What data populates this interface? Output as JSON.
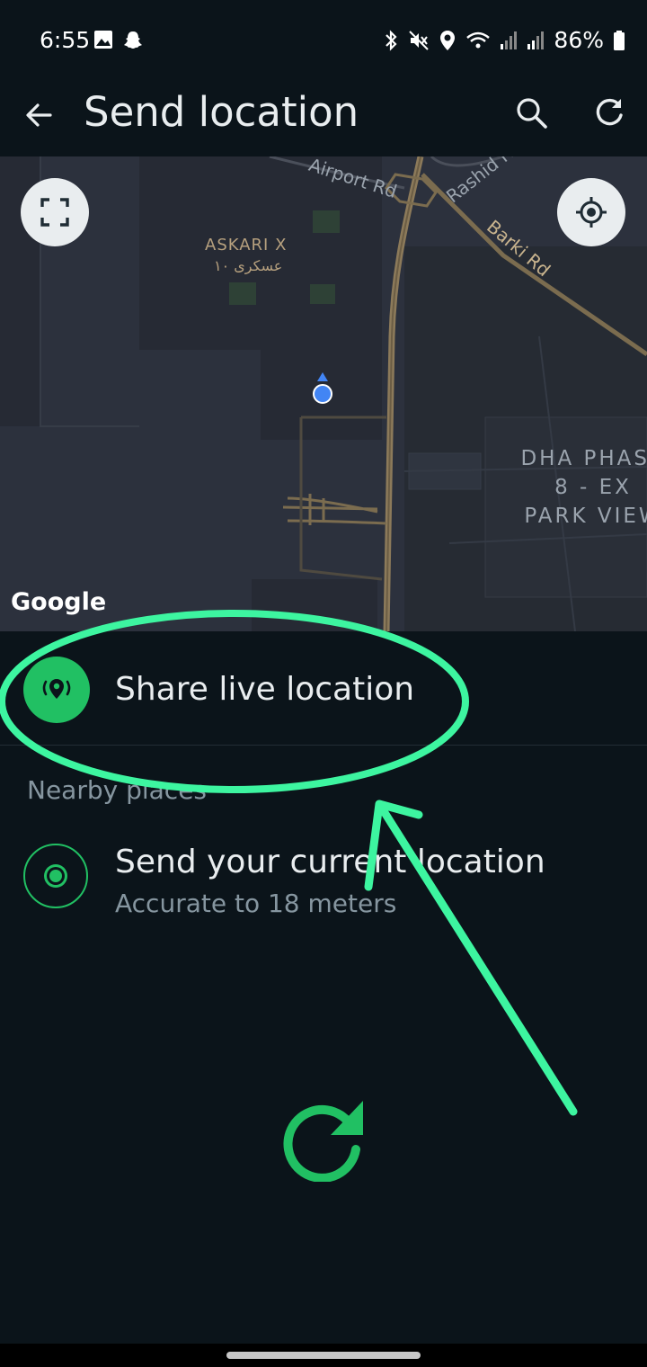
{
  "status_bar": {
    "time": "6:55",
    "battery_text": "86%",
    "left_icons": [
      "gallery-icon",
      "snapchat-icon"
    ],
    "right_icons": [
      "bluetooth-icon",
      "mute-icon",
      "location-icon",
      "wifi-icon",
      "signal-icon",
      "signal-icon",
      "battery-icon"
    ]
  },
  "app_bar": {
    "title": "Send location",
    "actions": [
      "back-arrow-icon",
      "search-icon",
      "refresh-icon"
    ]
  },
  "map": {
    "labels": {
      "askari": "ASKARI X",
      "askari_ar": "عسکری ۱۰",
      "airport_rd": "Airport Rd",
      "rashid_rd": "Rashid R",
      "barki_rd": "Barki Rd",
      "dha_line1": "DHA PHASE",
      "dha_line2": "8 - EX",
      "dha_line3": "PARK VIEW"
    },
    "attribution": "Google",
    "controls": [
      "expand-icon",
      "my-location-icon"
    ]
  },
  "share_live": {
    "label": "Share live location"
  },
  "nearby": {
    "section_label": "Nearby places",
    "current": {
      "title": "Send your current location",
      "subtitle": "Accurate to 18 meters"
    }
  },
  "colors": {
    "accent": "#21c063",
    "annotation": "#3df5a0",
    "background": "#0b141a"
  }
}
